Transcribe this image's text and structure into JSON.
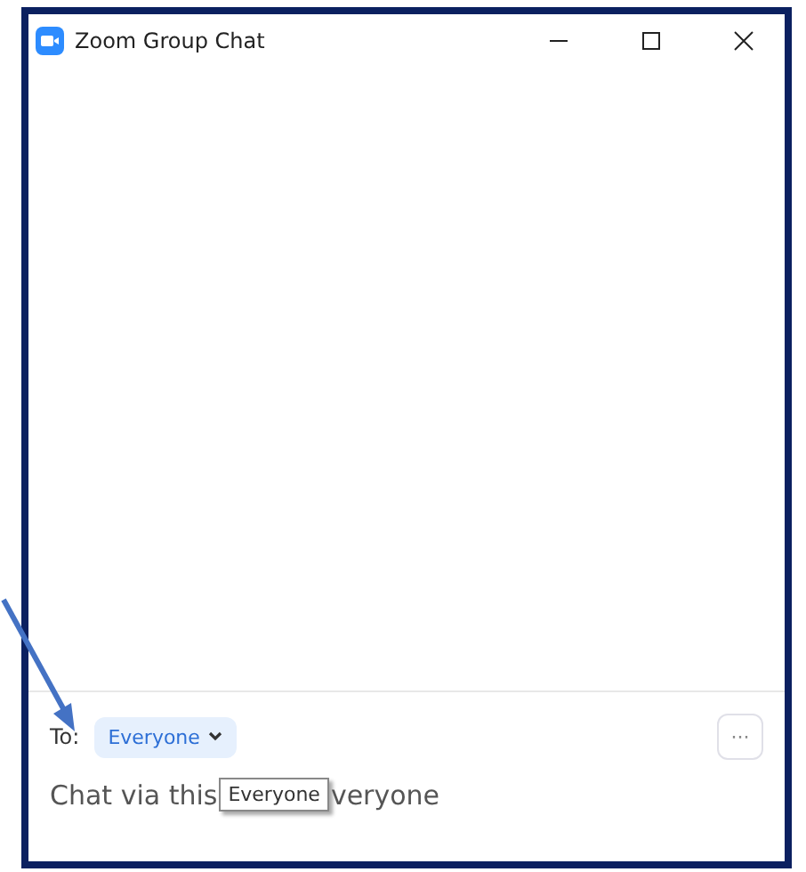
{
  "window": {
    "title": "Zoom Group Chat"
  },
  "recipient": {
    "label": "To:",
    "value": "Everyone"
  },
  "more_button": {
    "label": "···"
  },
  "message": {
    "text_before": "Chat via this",
    "tooltip": "Everyone",
    "text_after": "veryone"
  }
}
